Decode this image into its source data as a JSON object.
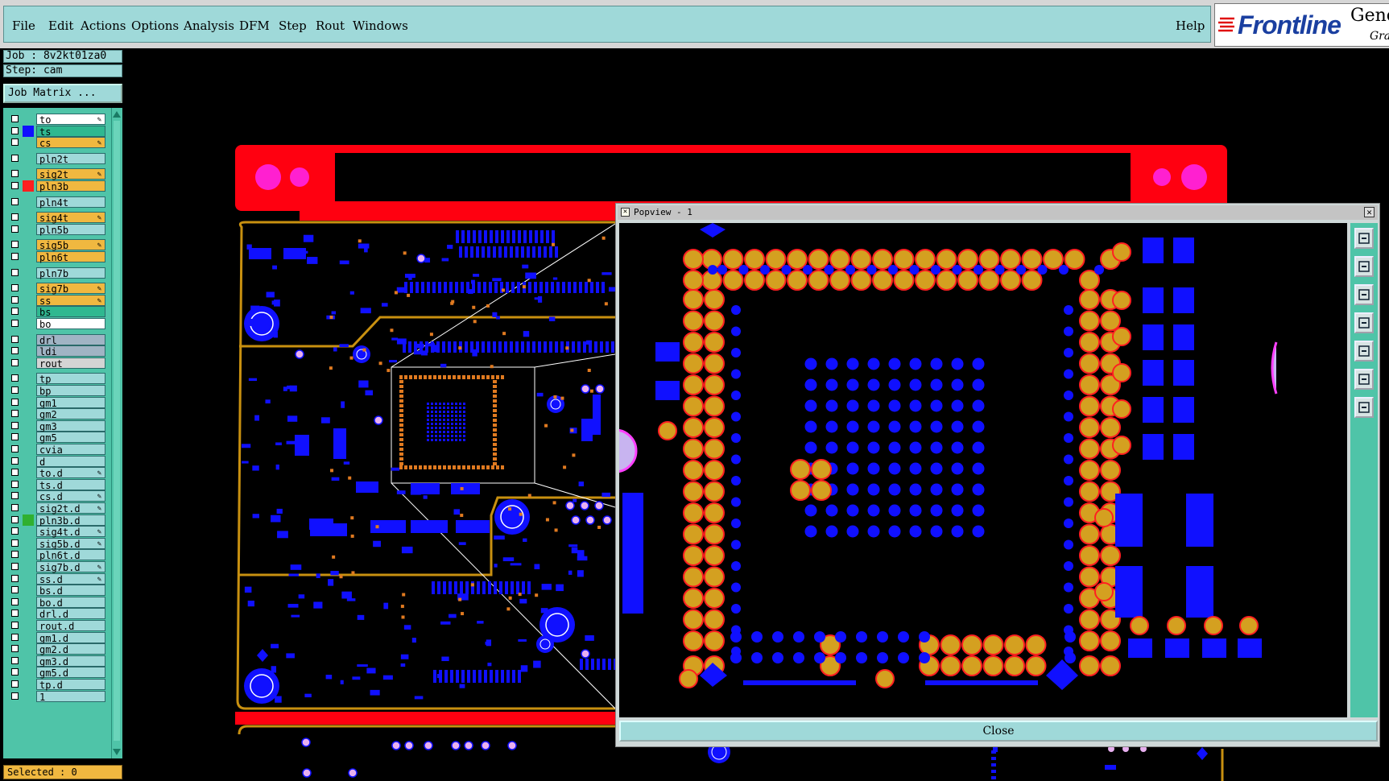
{
  "menubar": {
    "items": [
      {
        "label": "File"
      },
      {
        "label": "Edit"
      },
      {
        "label": "Actions"
      },
      {
        "label": "Options"
      },
      {
        "label": "Analysis"
      },
      {
        "label": "DFM"
      },
      {
        "label": "Step"
      },
      {
        "label": "Rout"
      },
      {
        "label": "Windows"
      }
    ],
    "help": "Help"
  },
  "logo": {
    "brand": "Frontline",
    "product": "Gene",
    "sub": "Gra"
  },
  "job": {
    "job_line": "Job : 8v2kt01za0",
    "step_line": "Step: cam",
    "matrix_button": "Job Matrix ..."
  },
  "layers": [
    {
      "name": "to",
      "color": "#ffffff",
      "swatch": "",
      "edit": true
    },
    {
      "name": "ts",
      "color": "#2fb890",
      "swatch": "#1010ff",
      "edit": false
    },
    {
      "name": "cs",
      "color": "#f0b840",
      "swatch": "",
      "edit": true
    },
    {
      "name": "pln2t",
      "color": "#9fd9d9",
      "swatch": "",
      "edit": false
    },
    {
      "name": "sig2t",
      "color": "#f0b840",
      "swatch": "",
      "edit": true
    },
    {
      "name": "pln3b",
      "color": "#f0b840",
      "swatch": "#ff2020",
      "edit": false
    },
    {
      "name": "pln4t",
      "color": "#9fd9d9",
      "swatch": "",
      "edit": false
    },
    {
      "name": "sig4t",
      "color": "#f0b840",
      "swatch": "",
      "edit": true
    },
    {
      "name": "pln5b",
      "color": "#9fd9d9",
      "swatch": "",
      "edit": false
    },
    {
      "name": "sig5b",
      "color": "#f0b840",
      "swatch": "",
      "edit": true
    },
    {
      "name": "pln6t",
      "color": "#f0b840",
      "swatch": "",
      "edit": false
    },
    {
      "name": "pln7b",
      "color": "#9fd9d9",
      "swatch": "",
      "edit": false
    },
    {
      "name": "sig7b",
      "color": "#f0b840",
      "swatch": "",
      "edit": true
    },
    {
      "name": "ss",
      "color": "#f0b840",
      "swatch": "",
      "edit": true
    },
    {
      "name": "bs",
      "color": "#2fb890",
      "swatch": "",
      "edit": false
    },
    {
      "name": "bo",
      "color": "#ffffff",
      "swatch": "",
      "edit": false
    },
    {
      "name": "drl",
      "color": "#a0b4c4",
      "swatch": "",
      "edit": false
    },
    {
      "name": "ldi",
      "color": "#a0b4c4",
      "swatch": "",
      "edit": false
    },
    {
      "name": "rout",
      "color": "#d4d4d4",
      "swatch": "",
      "edit": false
    },
    {
      "name": "tp",
      "color": "#9fd9d9",
      "swatch": "",
      "edit": false
    },
    {
      "name": "bp",
      "color": "#9fd9d9",
      "swatch": "",
      "edit": false
    },
    {
      "name": "gm1",
      "color": "#9fd9d9",
      "swatch": "",
      "edit": false
    },
    {
      "name": "gm2",
      "color": "#9fd9d9",
      "swatch": "",
      "edit": false
    },
    {
      "name": "gm3",
      "color": "#9fd9d9",
      "swatch": "",
      "edit": false
    },
    {
      "name": "gm5",
      "color": "#9fd9d9",
      "swatch": "",
      "edit": false
    },
    {
      "name": "cvia",
      "color": "#9fd9d9",
      "swatch": "",
      "edit": false
    },
    {
      "name": "d",
      "color": "#9fd9d9",
      "swatch": "",
      "edit": false
    },
    {
      "name": "to.d",
      "color": "#9fd9d9",
      "swatch": "",
      "edit": true
    },
    {
      "name": "ts.d",
      "color": "#9fd9d9",
      "swatch": "",
      "edit": false
    },
    {
      "name": "cs.d",
      "color": "#9fd9d9",
      "swatch": "",
      "edit": true
    },
    {
      "name": "sig2t.d",
      "color": "#9fd9d9",
      "swatch": "",
      "edit": true
    },
    {
      "name": "pln3b.d",
      "color": "#9fd9d9",
      "swatch": "#30b030",
      "edit": false
    },
    {
      "name": "sig4t.d",
      "color": "#9fd9d9",
      "swatch": "",
      "edit": true
    },
    {
      "name": "sig5b.d",
      "color": "#9fd9d9",
      "swatch": "",
      "edit": true
    },
    {
      "name": "pln6t.d",
      "color": "#9fd9d9",
      "swatch": "",
      "edit": false
    },
    {
      "name": "sig7b.d",
      "color": "#9fd9d9",
      "swatch": "",
      "edit": true
    },
    {
      "name": "ss.d",
      "color": "#9fd9d9",
      "swatch": "",
      "edit": true
    },
    {
      "name": "bs.d",
      "color": "#9fd9d9",
      "swatch": "",
      "edit": false
    },
    {
      "name": "bo.d",
      "color": "#9fd9d9",
      "swatch": "",
      "edit": false
    },
    {
      "name": "drl.d",
      "color": "#9fd9d9",
      "swatch": "",
      "edit": false
    },
    {
      "name": "rout.d",
      "color": "#9fd9d9",
      "swatch": "",
      "edit": false
    },
    {
      "name": "gm1.d",
      "color": "#9fd9d9",
      "swatch": "",
      "edit": false
    },
    {
      "name": "gm2.d",
      "color": "#9fd9d9",
      "swatch": "",
      "edit": false
    },
    {
      "name": "gm3.d",
      "color": "#9fd9d9",
      "swatch": "",
      "edit": false
    },
    {
      "name": "gm5.d",
      "color": "#9fd9d9",
      "swatch": "",
      "edit": false
    },
    {
      "name": "tp.d",
      "color": "#9fd9d9",
      "swatch": "",
      "edit": false
    },
    {
      "name": "1",
      "color": "#9fd9d9",
      "swatch": "",
      "edit": false
    }
  ],
  "status": {
    "selected": "Selected : 0"
  },
  "popview": {
    "title": "Popview - 1",
    "close_label": "Close",
    "tools": [
      "view-home-icon",
      "layer-up-icon",
      "layer-down-icon",
      "pan-left-icon",
      "pan-right-icon",
      "zoom-fit-icon",
      "zoom-home-icon"
    ]
  },
  "colors": {
    "panel": "#9fd9d9",
    "active": "#f0b840",
    "pad_orange": "#d4a020",
    "pad_ring": "#ff2020",
    "copper_blue": "#1010ff",
    "outline": "#c89010",
    "board_red": "#ff0010"
  }
}
